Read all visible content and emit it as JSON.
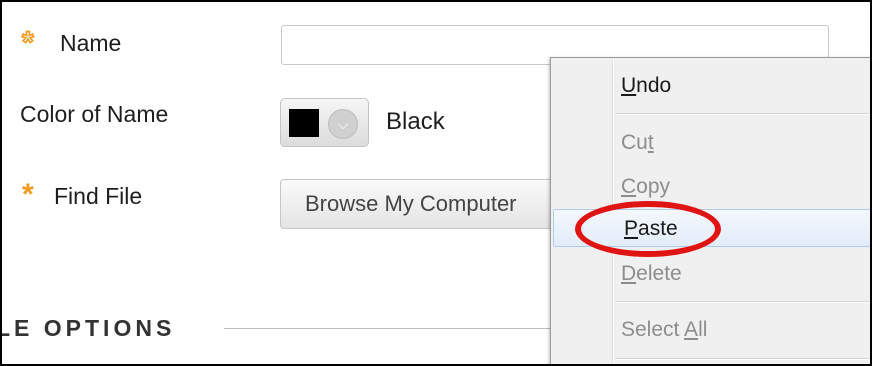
{
  "form": {
    "name_label": "Name",
    "name_value": "",
    "color_label": "Color of Name",
    "color_value": "Black",
    "swatch_color": "#000000",
    "find_file_label": "Find File",
    "browse_button": "Browse My Computer",
    "required_marker": "*",
    "required_color": "#f39a1e"
  },
  "section": {
    "title": "LE OPTIONS"
  },
  "context_menu": {
    "items": [
      {
        "pre": "",
        "key": "U",
        "post": "ndo",
        "state": "enabled"
      },
      {
        "pre": "Cu",
        "key": "t",
        "post": "",
        "state": "disabled"
      },
      {
        "pre": "",
        "key": "C",
        "post": "opy",
        "state": "disabled"
      },
      {
        "pre": "",
        "key": "P",
        "post": "aste",
        "state": "highlighted"
      },
      {
        "pre": "",
        "key": "D",
        "post": "elete",
        "state": "disabled"
      },
      {
        "pre": "Select ",
        "key": "A",
        "post": "ll",
        "state": "disabled"
      }
    ],
    "highlight_color": "#e2ecf9",
    "annotation_color": "#e11414"
  }
}
